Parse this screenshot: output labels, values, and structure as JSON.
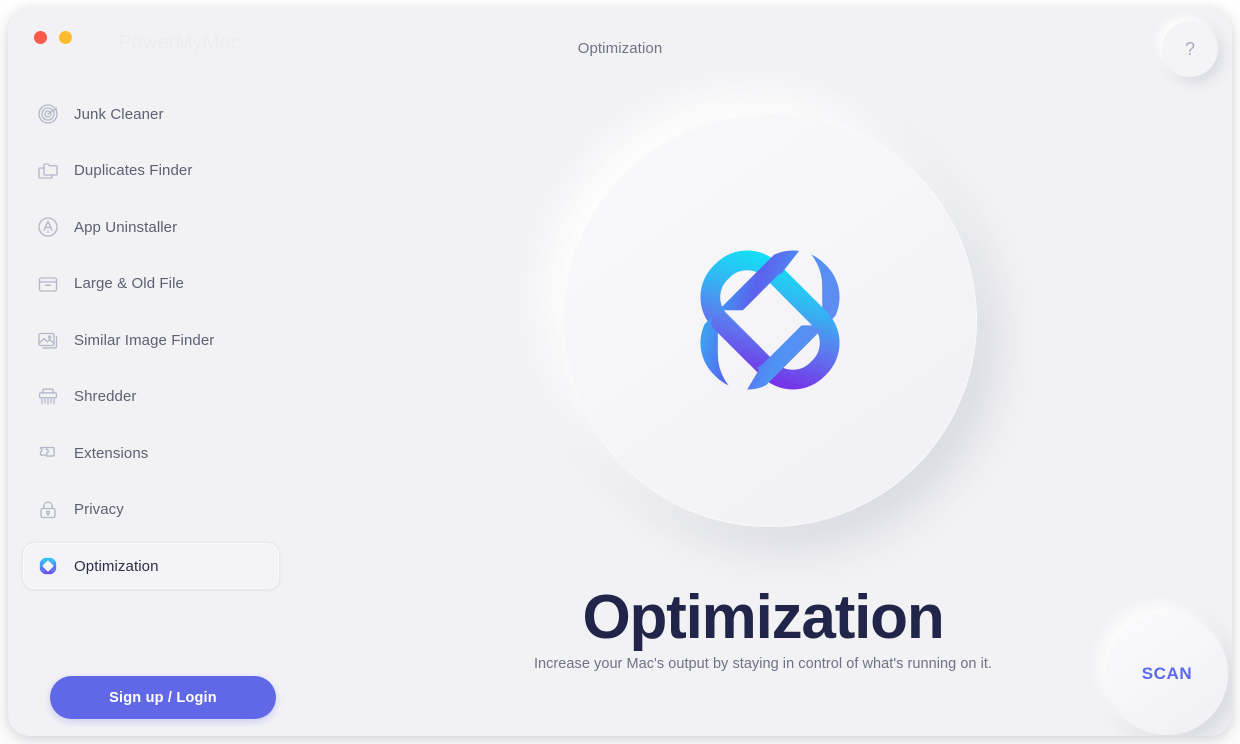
{
  "window": {
    "brand": "PowerMyMac",
    "title": "Optimization",
    "help_label": "?",
    "traffic_lights": [
      "close",
      "minimize"
    ]
  },
  "sidebar": {
    "items": [
      {
        "label": "Junk Cleaner",
        "icon": "junk-cleaner-icon",
        "selected": false
      },
      {
        "label": "Duplicates Finder",
        "icon": "duplicates-finder-icon",
        "selected": false
      },
      {
        "label": "App Uninstaller",
        "icon": "app-uninstaller-icon",
        "selected": false
      },
      {
        "label": "Large & Old File",
        "icon": "large-old-file-icon",
        "selected": false
      },
      {
        "label": "Similar Image Finder",
        "icon": "similar-image-finder-icon",
        "selected": false
      },
      {
        "label": "Shredder",
        "icon": "shredder-icon",
        "selected": false
      },
      {
        "label": "Extensions",
        "icon": "extensions-icon",
        "selected": false
      },
      {
        "label": "Privacy",
        "icon": "privacy-icon",
        "selected": false
      },
      {
        "label": "Optimization",
        "icon": "optimization-icon",
        "selected": true
      }
    ],
    "signup_label": "Sign up / Login"
  },
  "main": {
    "heading": "Optimization",
    "subtitle": "Increase your Mac's output by staying in control of what's running on it.",
    "logo_icon": "optimization-knot-logo",
    "scan_label": "SCAN"
  },
  "colors": {
    "background": "#f2f2f5",
    "accent_purple": "#6068e8",
    "scan_text": "#5b6ae8",
    "heading": "#202549",
    "logo_gradient_start": "#22d3ee",
    "logo_gradient_end": "#6d3ce8",
    "traffic_close": "#fb5a4b",
    "traffic_minimize": "#fcbc2e"
  }
}
